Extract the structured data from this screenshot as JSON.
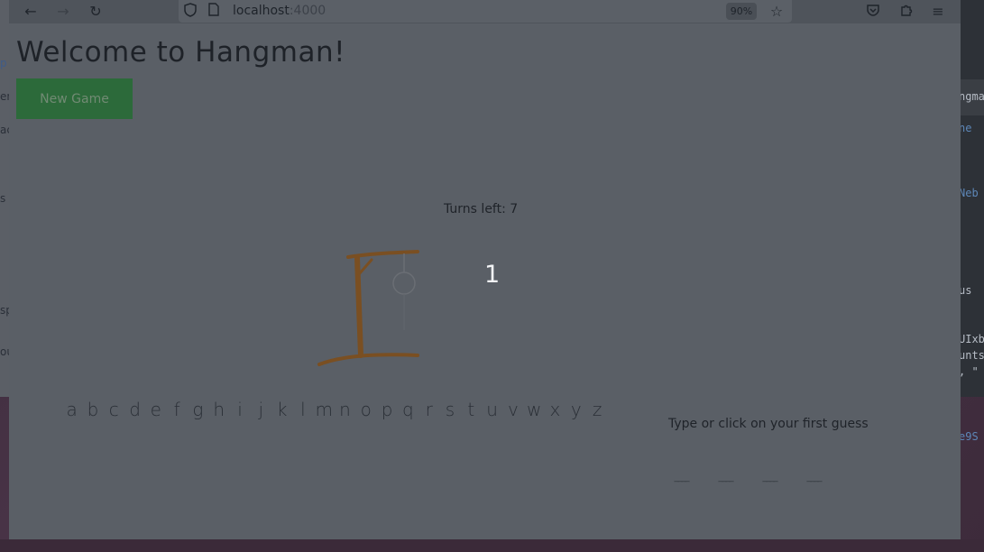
{
  "browser": {
    "url_host": "localhost",
    "url_port": ":4000",
    "zoom": "90%",
    "icons": [
      "back-icon",
      "forward-icon",
      "reload-icon",
      "shield-icon",
      "page-icon",
      "bookmark-star-icon",
      "pocket-icon",
      "extensions-icon",
      "menu-icon"
    ]
  },
  "background": {
    "left_snippets": [
      "p",
      "en",
      "ac",
      "s",
      "sp",
      "ou"
    ],
    "right_snippets": [
      "ngma",
      "ne",
      "Neb",
      "us",
      "UIxb",
      "unts",
      ", \"",
      "e9S"
    ]
  },
  "page": {
    "title": "Welcome to Hangman!",
    "new_game_label": "New Game",
    "turns_left_label": "Turns left: 7",
    "countdown": "1",
    "alphabet": [
      "a",
      "b",
      "c",
      "d",
      "e",
      "f",
      "g",
      "h",
      "i",
      "j",
      "k",
      "l",
      "m",
      "n",
      "o",
      "p",
      "q",
      "r",
      "s",
      "t",
      "u",
      "v",
      "w",
      "x",
      "y",
      "z"
    ],
    "prompt": "Type or click on your first guess",
    "word_blanks": [
      "____",
      "____",
      "____",
      "____"
    ]
  },
  "colors": {
    "button_bg": "#2c6a3a",
    "overlay_text": "#f2f3f5",
    "gallows_wood": "#7a4f22"
  }
}
